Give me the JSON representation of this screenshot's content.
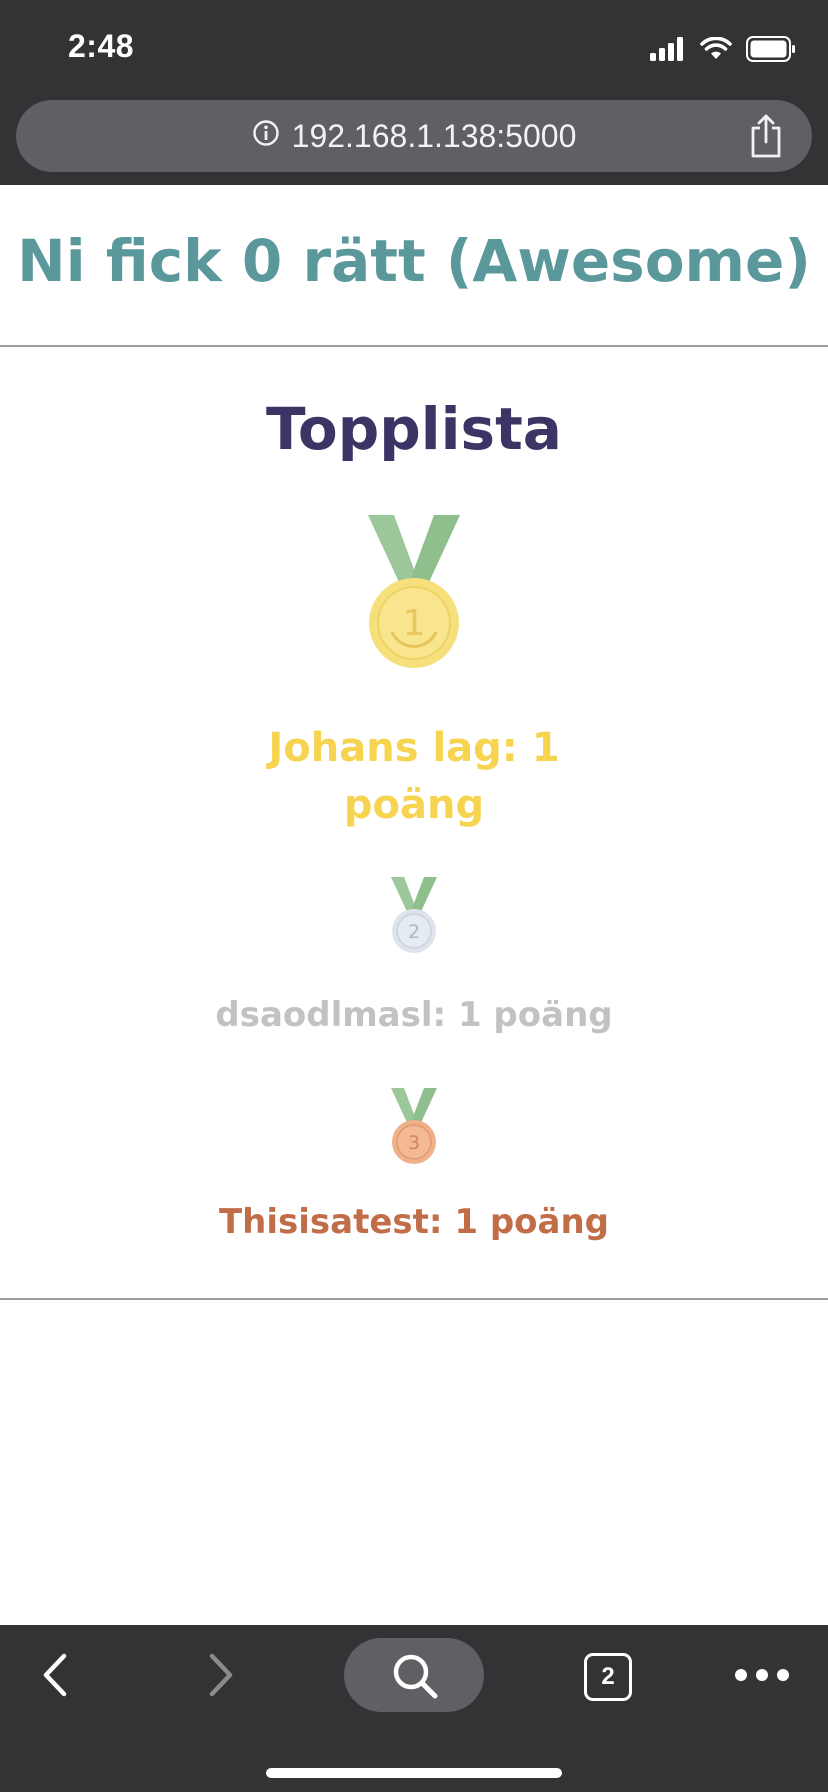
{
  "status_bar": {
    "time": "2:48",
    "icons": [
      "signal-icon",
      "wifi-icon",
      "battery-icon"
    ]
  },
  "browser": {
    "url": "192.168.1.138:5000",
    "tab_count": "2"
  },
  "page": {
    "result_title": "Ni fick 0 rätt (Awesome)",
    "leaderboard_title": "Topplista",
    "entries": [
      {
        "rank": "1",
        "text": "Johans lag: 1 poäng",
        "color": "#f6d44f"
      },
      {
        "rank": "2",
        "text": "dsaodlmasl: 1 poäng",
        "color": "#c2c2c2"
      },
      {
        "rank": "3",
        "text": "Thisisatest: 1 poäng",
        "color": "#c16e48"
      }
    ]
  },
  "colors": {
    "chrome_bg": "#323335",
    "url_bar_bg": "#5e6064",
    "title_teal": "#5b989c",
    "leaderboard_navy": "#3a3564",
    "medal_ribbon": "#9cc79a",
    "gold": "#f6d44f",
    "silver": "#c2c2c2",
    "bronze": "#c16e48"
  }
}
